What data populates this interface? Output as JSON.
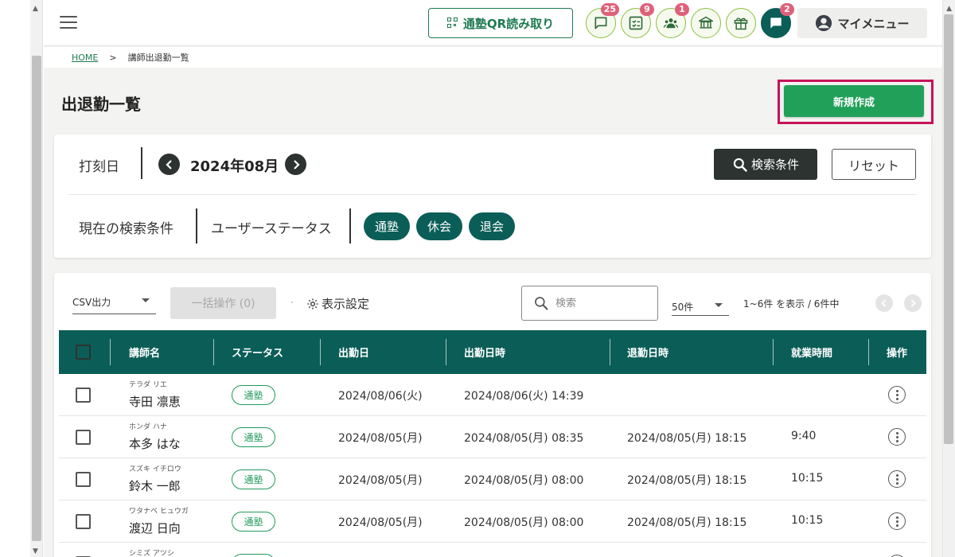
{
  "topbar": {
    "qr_button_label": "通塾QR読み取り",
    "icons": [
      {
        "name": "message-icon",
        "badge": "25"
      },
      {
        "name": "checklist-icon",
        "badge": "9"
      },
      {
        "name": "group-icon",
        "badge": "1"
      },
      {
        "name": "school-icon",
        "badge": ""
      },
      {
        "name": "gift-icon",
        "badge": ""
      },
      {
        "name": "chat-icon",
        "badge": "2"
      }
    ],
    "badges": {
      "messages": "25",
      "checklist": "9",
      "group": "1",
      "chat": "2"
    },
    "my_menu_label": "マイメニュー"
  },
  "breadcrumb": {
    "home": "HOME",
    "separator": ">",
    "current": "講師出退勤一覧"
  },
  "page": {
    "title": "出退勤一覧",
    "new_button_label": "新規作成"
  },
  "search": {
    "date_label": "打刻日",
    "month": "2024年08月",
    "search_conditions_label": "検索条件",
    "reset_label": "リセット",
    "current_conditions_label": "現在の検索条件",
    "user_status_label": "ユーザーステータス",
    "status_chips": [
      "通塾",
      "休会",
      "退会"
    ]
  },
  "toolbar": {
    "csv_label": "CSV出力",
    "bulk_label": "一括操作 (0)",
    "dot": "·",
    "display_settings_label": "表示設定",
    "search_placeholder": "検索",
    "per_page": "50件",
    "count_text": "1~6件 を表示 / 6件中"
  },
  "table": {
    "headers": [
      "講師名",
      "ステータス",
      "出勤日",
      "出勤日時",
      "退勤日時",
      "就業時間",
      "操作"
    ],
    "rows": [
      {
        "kana": "テラダ リエ",
        "name": "寺田 凛恵",
        "status": "通塾",
        "date": "2024/08/06(火)",
        "clock_in": "2024/08/06(火) 14:39",
        "clock_out": "",
        "hours": ""
      },
      {
        "kana": "ホンダ ハナ",
        "name": "本多 はな",
        "status": "通塾",
        "date": "2024/08/05(月)",
        "clock_in": "2024/08/05(月) 08:35",
        "clock_out": "2024/08/05(月) 18:15",
        "hours": "9:40"
      },
      {
        "kana": "スズキ イチロウ",
        "name": "鈴木 一郎",
        "status": "通塾",
        "date": "2024/08/05(月)",
        "clock_in": "2024/08/05(月) 08:00",
        "clock_out": "2024/08/05(月) 18:15",
        "hours": "10:15"
      },
      {
        "kana": "ワタナベ ヒュウガ",
        "name": "渡辺 日向",
        "status": "通塾",
        "date": "2024/08/05(月)",
        "clock_in": "2024/08/05(月) 08:00",
        "clock_out": "2024/08/05(月) 18:15",
        "hours": "10:15"
      },
      {
        "kana": "シミズ アツシ",
        "name": "",
        "status": "",
        "date": "",
        "clock_in": "",
        "clock_out": "",
        "hours": ""
      }
    ]
  },
  "colors": {
    "primary_dark": "#0b5e57",
    "accent_green": "#21a05a",
    "badge_pink": "#e0607a",
    "highlight": "#c8115a"
  }
}
